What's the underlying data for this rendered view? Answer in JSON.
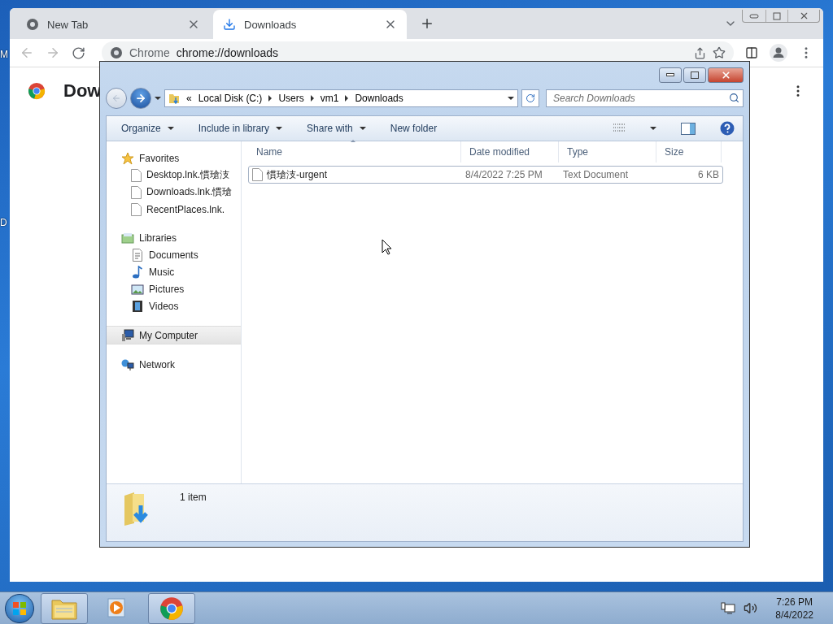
{
  "desktop": {
    "icon_labels": [
      "M",
      "D"
    ]
  },
  "browser": {
    "tabs": [
      {
        "title": "New Tab",
        "selected": false,
        "kind": "chrome"
      },
      {
        "title": "Downloads",
        "selected": true,
        "kind": "download"
      }
    ],
    "omnibox": {
      "site_label": "Chrome",
      "url": "chrome://downloads"
    },
    "page": {
      "heading": "Dow"
    }
  },
  "explorer": {
    "breadcrumb": {
      "overflow": "«",
      "segments": [
        "Local Disk (C:)",
        "Users",
        "vm1",
        "Downloads"
      ]
    },
    "search": {
      "placeholder": "Search Downloads"
    },
    "toolbar": [
      {
        "label": "Organize",
        "dropdown": true
      },
      {
        "label": "Include in library",
        "dropdown": true
      },
      {
        "label": "Share with",
        "dropdown": true
      },
      {
        "label": "New folder",
        "dropdown": false
      }
    ],
    "nav": [
      {
        "label": "Favorites",
        "kind": "star",
        "selected": false,
        "children": [
          {
            "label": "Desktop.lnk.慣瑲汥",
            "kind": "file",
            "selected": false
          },
          {
            "label": "Downloads.lnk.慣瑲",
            "kind": "file",
            "selected": false
          },
          {
            "label": "RecentPlaces.lnk.",
            "kind": "file",
            "selected": false
          }
        ]
      },
      {
        "label": "Libraries",
        "kind": "library",
        "selected": false,
        "children": [
          {
            "label": "Documents",
            "kind": "documents",
            "selected": false
          },
          {
            "label": "Music",
            "kind": "music",
            "selected": false
          },
          {
            "label": "Pictures",
            "kind": "pictures",
            "selected": false
          },
          {
            "label": "Videos",
            "kind": "videos",
            "selected": false
          }
        ]
      },
      {
        "label": "My Computer",
        "kind": "computer",
        "selected": true
      },
      {
        "label": "Network",
        "kind": "network",
        "selected": false
      }
    ],
    "columns": [
      "Name",
      "Date modified",
      "Type",
      "Size"
    ],
    "rows": [
      {
        "cells": [
          "慣瑲汥-urgent",
          "8/4/2022 7:25 PM",
          "Text Document",
          "6 KB"
        ],
        "selected": true
      }
    ],
    "status": "1 item"
  },
  "taskbar": {
    "buttons": [
      {
        "kind": "explorer",
        "open": true
      },
      {
        "kind": "media",
        "open": false
      },
      {
        "kind": "chrome",
        "open": true
      }
    ],
    "clock": {
      "time": "7:26 PM",
      "date": "8/4/2022"
    }
  }
}
